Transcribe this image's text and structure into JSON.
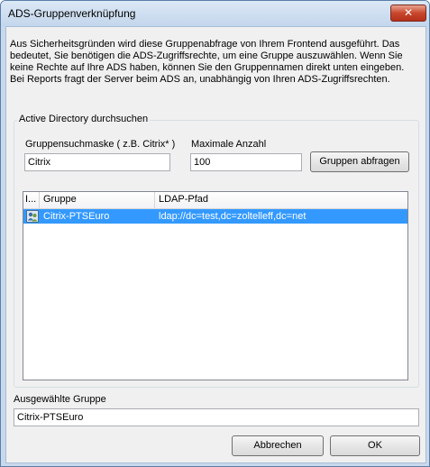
{
  "window": {
    "title": "ADS-Gruppenverknüpfung",
    "close_glyph": "✕"
  },
  "info": {
    "text": "Aus Sicherheitsgründen wird diese Gruppenabfrage von Ihrem Frontend ausgeführt. Das bedeutet, Sie benötigen die ADS-Zugriffsrechte, um eine Gruppe auszuwählen. Wenn Sie keine Rechte auf Ihre ADS haben, können Sie den Gruppennamen direkt unten eingeben. Bei Reports fragt der Server beim ADS an, unabhängig von Ihren ADS-Zugriffsrechten."
  },
  "search": {
    "legend": "Active Directory durchsuchen",
    "mask_label": "Gruppensuchmaske ( z.B. Citrix* )",
    "mask_value": "Citrix",
    "max_label": "Maximale Anzahl",
    "max_value": "100",
    "query_button": "Gruppen abfragen"
  },
  "list": {
    "columns": [
      "I...",
      "Gruppe",
      "LDAP-Pfad"
    ],
    "rows": [
      {
        "icon": "group-icon",
        "gruppe": "Citrix-PTSEuro",
        "ldap": "ldap://dc=test,dc=zoltelleff,dc=net",
        "selected": true
      }
    ]
  },
  "selected": {
    "label": "Ausgewählte Gruppe",
    "value": "Citrix-PTSEuro"
  },
  "buttons": {
    "cancel": "Abbrechen",
    "ok": "OK"
  },
  "colors": {
    "selection": "#3399ff",
    "close_button": "#c8472c"
  }
}
